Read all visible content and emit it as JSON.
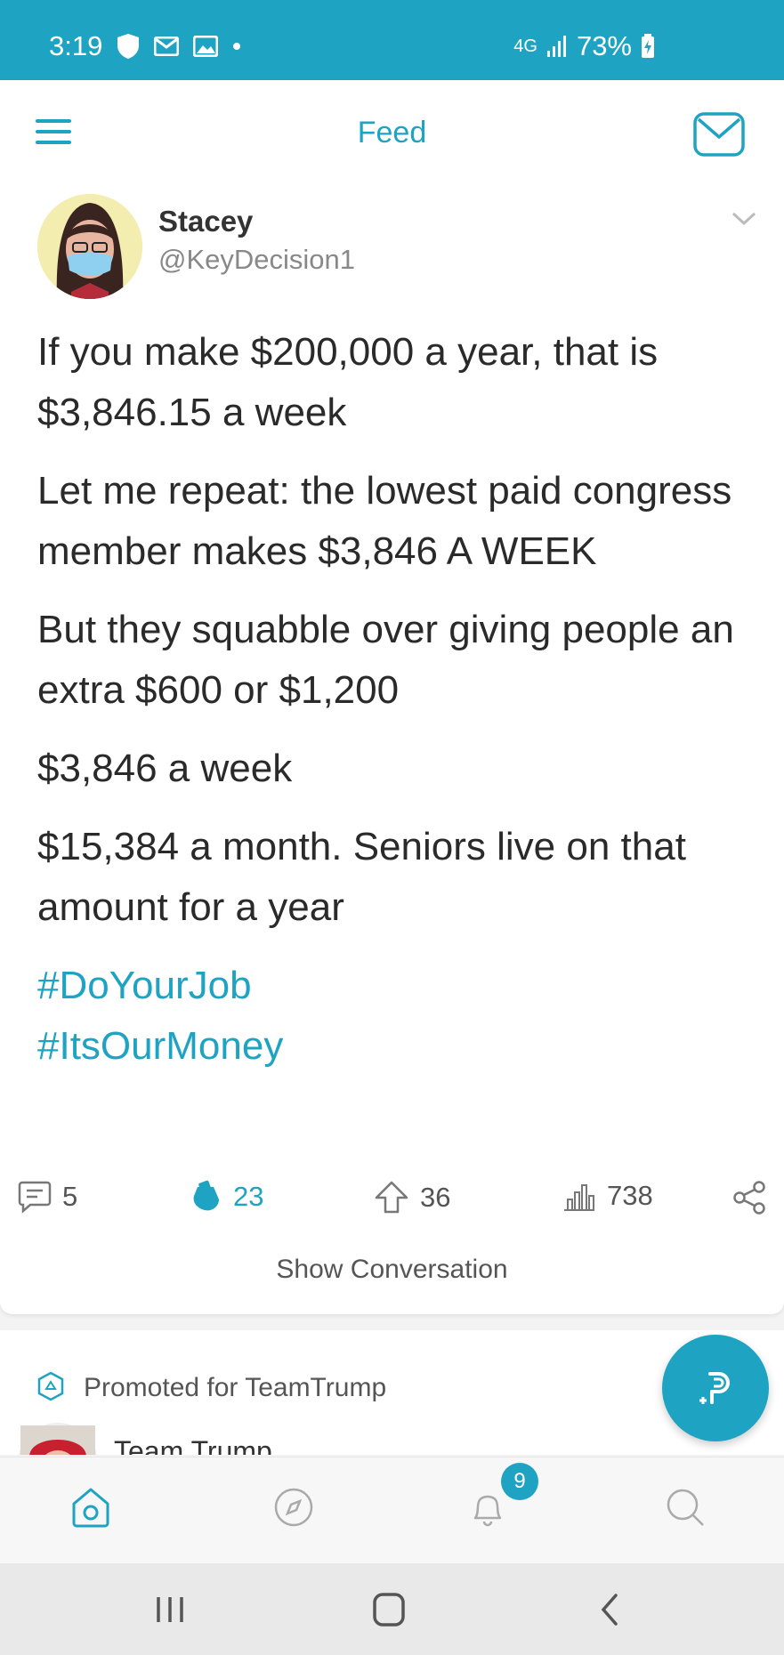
{
  "status_bar": {
    "time": "3:19",
    "network": "4G",
    "battery": "73%"
  },
  "app_bar": {
    "title": "Feed"
  },
  "post": {
    "author_name": "Stacey",
    "author_handle": "@KeyDecision1",
    "paragraphs": [
      "If you make $200,000 a year, that is $3,846.15 a week",
      "Let me repeat: the lowest paid congress member makes $3,846 A WEEK",
      "But they squabble over giving people an extra $600 or $1,200",
      "$3,846 a week",
      "$15,384 a month. Seniors live on that amount for a year"
    ],
    "hashtags": [
      "#DoYourJob",
      "#ItsOurMoney"
    ],
    "actions": {
      "comments": "5",
      "upvotes_active": "23",
      "reposts": "36",
      "views": "738"
    },
    "show_conversation": "Show Conversation"
  },
  "promo": {
    "label": "Promoted for TeamTrump",
    "name": "Team Trump"
  },
  "tab_bar": {
    "notification_count": "9"
  },
  "colors": {
    "accent": "#1fa3c2"
  }
}
